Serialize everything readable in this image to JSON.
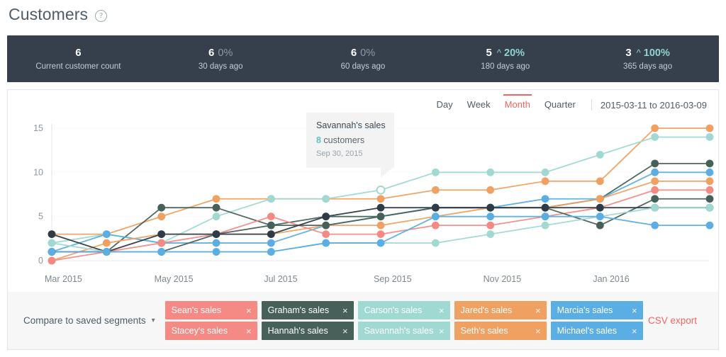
{
  "header": {
    "title": "Customers",
    "help_icon": "question-mark-icon"
  },
  "stats": [
    {
      "value": "6",
      "delta": "",
      "arrow": "",
      "label": "Current customer count",
      "trend": "none"
    },
    {
      "value": "6",
      "delta": "0%",
      "arrow": "",
      "label": "30 days ago",
      "trend": "flat"
    },
    {
      "value": "6",
      "delta": "0%",
      "arrow": "",
      "label": "60 days ago",
      "trend": "flat"
    },
    {
      "value": "5",
      "delta": "20%",
      "arrow": "^",
      "label": "180 days ago",
      "trend": "up"
    },
    {
      "value": "3",
      "delta": "100%",
      "arrow": "^",
      "label": "365 days ago",
      "trend": "up"
    }
  ],
  "chart_controls": {
    "tabs": [
      {
        "label": "Day",
        "active": false
      },
      {
        "label": "Week",
        "active": false
      },
      {
        "label": "Month",
        "active": true
      },
      {
        "label": "Quarter",
        "active": false
      }
    ],
    "date_range": "2015-03-11 to 2016-03-09"
  },
  "tooltip": {
    "title": "Savannah's sales",
    "count": "8",
    "count_suffix": " customers",
    "date": "Sep 30, 2015"
  },
  "footer": {
    "compare_label": "Compare to saved segments",
    "caret_icon": "chevron-down-icon",
    "csv_export": "CSV export",
    "close_icon": "close-icon"
  },
  "segments": [
    {
      "label": "Sean's sales",
      "color": "#f58a84"
    },
    {
      "label": "Graham's sales",
      "color": "#47615a"
    },
    {
      "label": "Carson's sales",
      "color": "#9fd9d2"
    },
    {
      "label": "Jared's sales",
      "color": "#f0a061"
    },
    {
      "label": "Marcia's sales",
      "color": "#5aaee4"
    },
    {
      "label": "Stacey's sales",
      "color": "#f58a84"
    },
    {
      "label": "Hannah's sales",
      "color": "#47615a"
    },
    {
      "label": "Savannah's sales",
      "color": "#9fd9d2"
    },
    {
      "label": "Seth's sales",
      "color": "#f0a061"
    },
    {
      "label": "Michael's sales",
      "color": "#5aaee4"
    }
  ],
  "chart_data": {
    "type": "line",
    "title": "",
    "xlabel": "",
    "ylabel": "",
    "ylim": [
      0,
      15
    ],
    "yticks": [
      0,
      5,
      10,
      15
    ],
    "grid": true,
    "legend_position": "bottom",
    "x": [
      "Mar 2015",
      "Apr 2015",
      "May 2015",
      "Jun 2015",
      "Jul 2015",
      "Aug 2015",
      "Sep 2015",
      "Oct 2015",
      "Nov 2015",
      "Dec 2015",
      "Jan 2016",
      "Feb 2016",
      "Mar 2016"
    ],
    "xtick_labels": [
      "Mar 2015",
      "May 2015",
      "Jul 2015",
      "Sep 2015",
      "Nov 2015",
      "Jan 2016"
    ],
    "xtick_indices": [
      0,
      2,
      4,
      6,
      8,
      10
    ],
    "highlight": {
      "series": "Savannah's sales",
      "x": "Sep 2015",
      "value": 8,
      "date": "Sep 30, 2015"
    },
    "series": [
      {
        "name": "Jared's sales",
        "color": "#f0a061",
        "values": [
          3,
          3,
          5,
          7,
          7,
          7,
          7,
          8,
          8,
          9,
          9,
          15,
          15
        ]
      },
      {
        "name": "Savannah's sales",
        "color": "#9fd9d2",
        "values": [
          2,
          3,
          2,
          5,
          7,
          7,
          8,
          10,
          10,
          10,
          12,
          14,
          14
        ]
      },
      {
        "name": "Hannah's sales",
        "color": "#47615a",
        "values": [
          1,
          1,
          6,
          6,
          4,
          5,
          5,
          6,
          6,
          6,
          7,
          11,
          11
        ]
      },
      {
        "name": "Marcia's sales",
        "color": "#5aaee4",
        "values": [
          1,
          3,
          2,
          2,
          2,
          4,
          5,
          6,
          6,
          7,
          7,
          10,
          10
        ]
      },
      {
        "name": "Seth's sales",
        "color": "#f0a061",
        "values": [
          0,
          2,
          3,
          3,
          3,
          4,
          4,
          5,
          6,
          6,
          7,
          9,
          9
        ]
      },
      {
        "name": "Sean's sales",
        "color": "#f58a84",
        "values": [
          0,
          1,
          2,
          3,
          5,
          3,
          3,
          4,
          4,
          5,
          6,
          8,
          8
        ]
      },
      {
        "name": "Graham's sales",
        "color": "#47615a",
        "values": [
          1,
          1,
          1,
          3,
          4,
          4,
          5,
          6,
          6,
          6,
          4,
          7,
          7
        ]
      },
      {
        "name": "Michael's sales",
        "color": "#2f3b47",
        "values": [
          3,
          1,
          3,
          3,
          3,
          5,
          6,
          6,
          6,
          6,
          6,
          6,
          6
        ]
      },
      {
        "name": "Carson's sales",
        "color": "#9fd9d2",
        "values": [
          2,
          1,
          1,
          1,
          1,
          2,
          2,
          2,
          3,
          4,
          5,
          6,
          6
        ]
      },
      {
        "name": "Stacey's sales",
        "color": "#5aaee4",
        "values": [
          1,
          1,
          1,
          1,
          1,
          2,
          2,
          5,
          5,
          5,
          5,
          4,
          4
        ]
      }
    ]
  }
}
